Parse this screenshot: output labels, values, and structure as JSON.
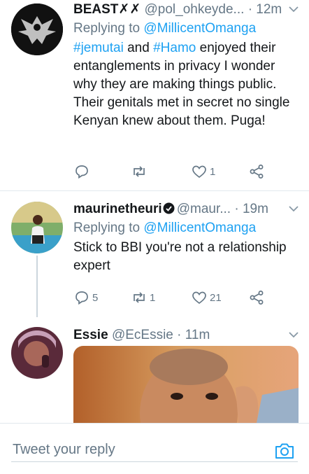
{
  "tweets": [
    {
      "name": "BEAST✗✗",
      "handle": "@pol_ohkeyde...",
      "time": "· 12m",
      "replying_prefix": "Replying to ",
      "replying_to": "@MillicentOmanga",
      "body_tag1": "#jemutai",
      "body_and": " and ",
      "body_tag2": "#Hamo",
      "body_text": " enjoyed their entanglements in privacy I wonder why they are making things public. Their genitals met in secret no single Kenyan knew about them. Puga!",
      "replies": "",
      "retweets": "",
      "likes": "1"
    },
    {
      "name": "maurinetheuri",
      "handle": "@maur...",
      "time": "· 19m",
      "replying_prefix": "Replying to ",
      "replying_to": "@MillicentOmanga",
      "body_text": "Stick to BBI you're not a relationship expert",
      "replies": "5",
      "retweets": "1",
      "likes": "21"
    },
    {
      "name": "Essie",
      "handle": "@EcEssie",
      "time": "· 11m"
    }
  ],
  "composer": {
    "placeholder": "Tweet your reply"
  },
  "colors": {
    "link": "#1da1f2",
    "secondary_text": "#657786",
    "divider": "#e1e8ed"
  }
}
